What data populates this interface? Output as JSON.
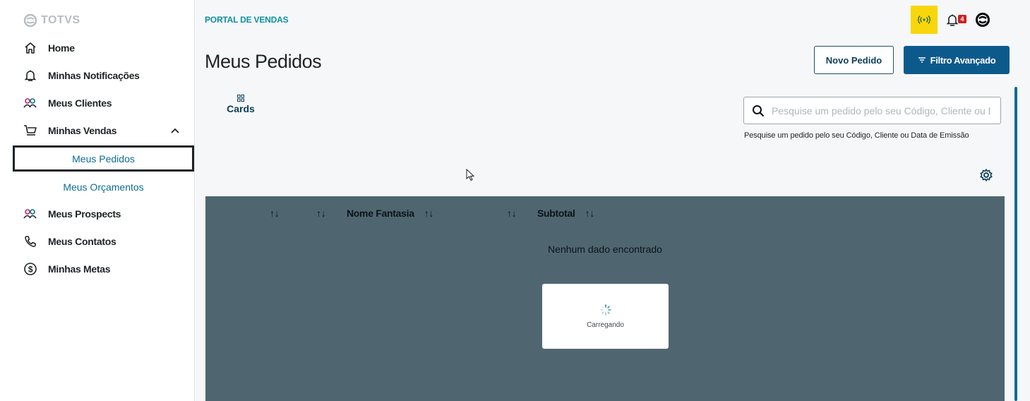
{
  "brand": {
    "logo_text": "TOTVS"
  },
  "sidebar": {
    "items": [
      {
        "label": "Home",
        "icon": "home-icon"
      },
      {
        "label": "Minhas Notificações",
        "icon": "bell-icon"
      },
      {
        "label": "Meus Clientes",
        "icon": "users-icon"
      },
      {
        "label": "Minhas Vendas",
        "icon": "cart-icon"
      },
      {
        "label": "Meus Prospects",
        "icon": "users-icon"
      },
      {
        "label": "Meus Contatos",
        "icon": "phone-icon"
      },
      {
        "label": "Minhas Metas",
        "icon": "dollar-circle-icon"
      }
    ],
    "subitems": [
      {
        "label": "Meus Pedidos",
        "active": true
      },
      {
        "label": "Meus Orçamentos",
        "active": false
      }
    ]
  },
  "header": {
    "breadcrumb": "PORTAL DE VENDAS",
    "notification_count": "4",
    "status_color": "#f7d70b"
  },
  "main": {
    "title": "Meus Pedidos",
    "new_order_label": "Novo Pedido",
    "filter_label": "Filtro Avançado",
    "view_toggle_label": "Cards",
    "search": {
      "placeholder": "Pesquise um pedido pelo seu Código, Cliente ou Data de Emissão",
      "help": "Pesquise um pedido pelo seu Código, Cliente ou Data de Emissão"
    },
    "table": {
      "columns": [
        "",
        "",
        "Nome Fantasia",
        "",
        "Subtotal"
      ],
      "empty_text": "Nenhum dado encontrado",
      "loading_text": "Carregando"
    }
  },
  "colors": {
    "primary": "#0c5a8c",
    "table_bg": "#4f6671",
    "badge": "#d21f1f"
  }
}
